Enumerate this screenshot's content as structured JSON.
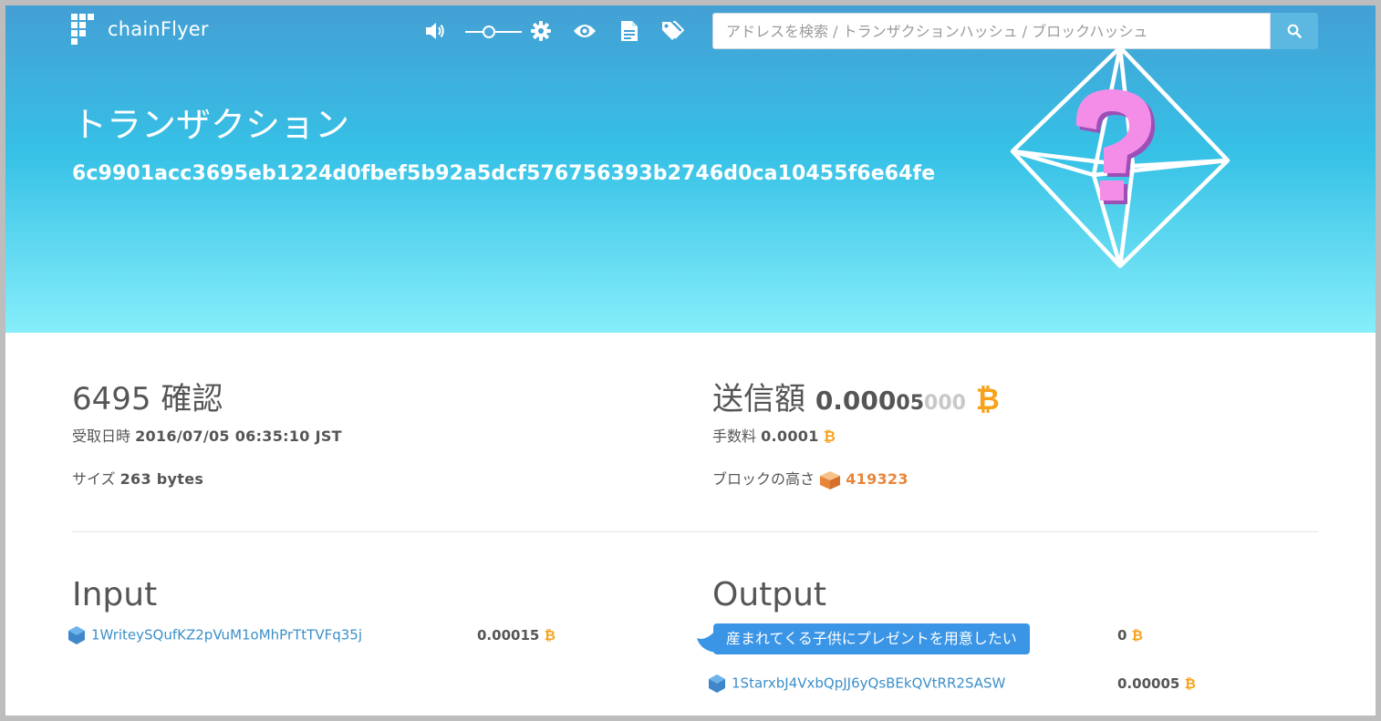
{
  "header": {
    "logo_text": "chainFlyer",
    "search": {
      "placeholder": "アドレスを検索 / トランザクションハッシュ / ブロックハッシュ"
    },
    "icons": [
      "volume-icon",
      "slider",
      "gear-icon",
      "eye-icon",
      "document-icon",
      "tags-icon",
      "search-icon"
    ]
  },
  "hero": {
    "title": "トランザクション",
    "hash": "6c9901acc3695eb1224d0fbef5b92a5dcf576756393b2746d0ca10455f6e64fe"
  },
  "summary": {
    "confirmations": "6495",
    "confirmations_label": "確認",
    "received_label": "受取日時",
    "received_value": "2016/07/05 06:35:10 JST",
    "size_label": "サイズ",
    "size_value": "263 bytes",
    "sent_label": "送信額",
    "sent_main": "0.000",
    "sent_mid": "05",
    "sent_gray": "000",
    "btc_symbol": "₿",
    "fee_label": "手数料",
    "fee_value": "0.0001",
    "block_label": "ブロックの高さ",
    "block_value": "419323"
  },
  "input": {
    "title": "Input",
    "items": [
      {
        "address": "1WriteySQufKZ2pVuM1oMhPrTtTVFq35j",
        "amount": "0.00015"
      }
    ]
  },
  "output": {
    "title": "Output",
    "items": [
      {
        "message": "産まれてくる子供にプレゼントを用意したい",
        "amount": "0"
      },
      {
        "address": "1StarxbJ4VxbQpJJ6yQsBEkQVtRR2SASW",
        "amount": "0.00005"
      }
    ]
  },
  "colors": {
    "hero_top": "#449fd4",
    "hero_bottom": "#86eefa",
    "link": "#3c8fc9",
    "btc": "#f7a21a",
    "block": "#e8853a",
    "bubble": "#3a95e6"
  }
}
